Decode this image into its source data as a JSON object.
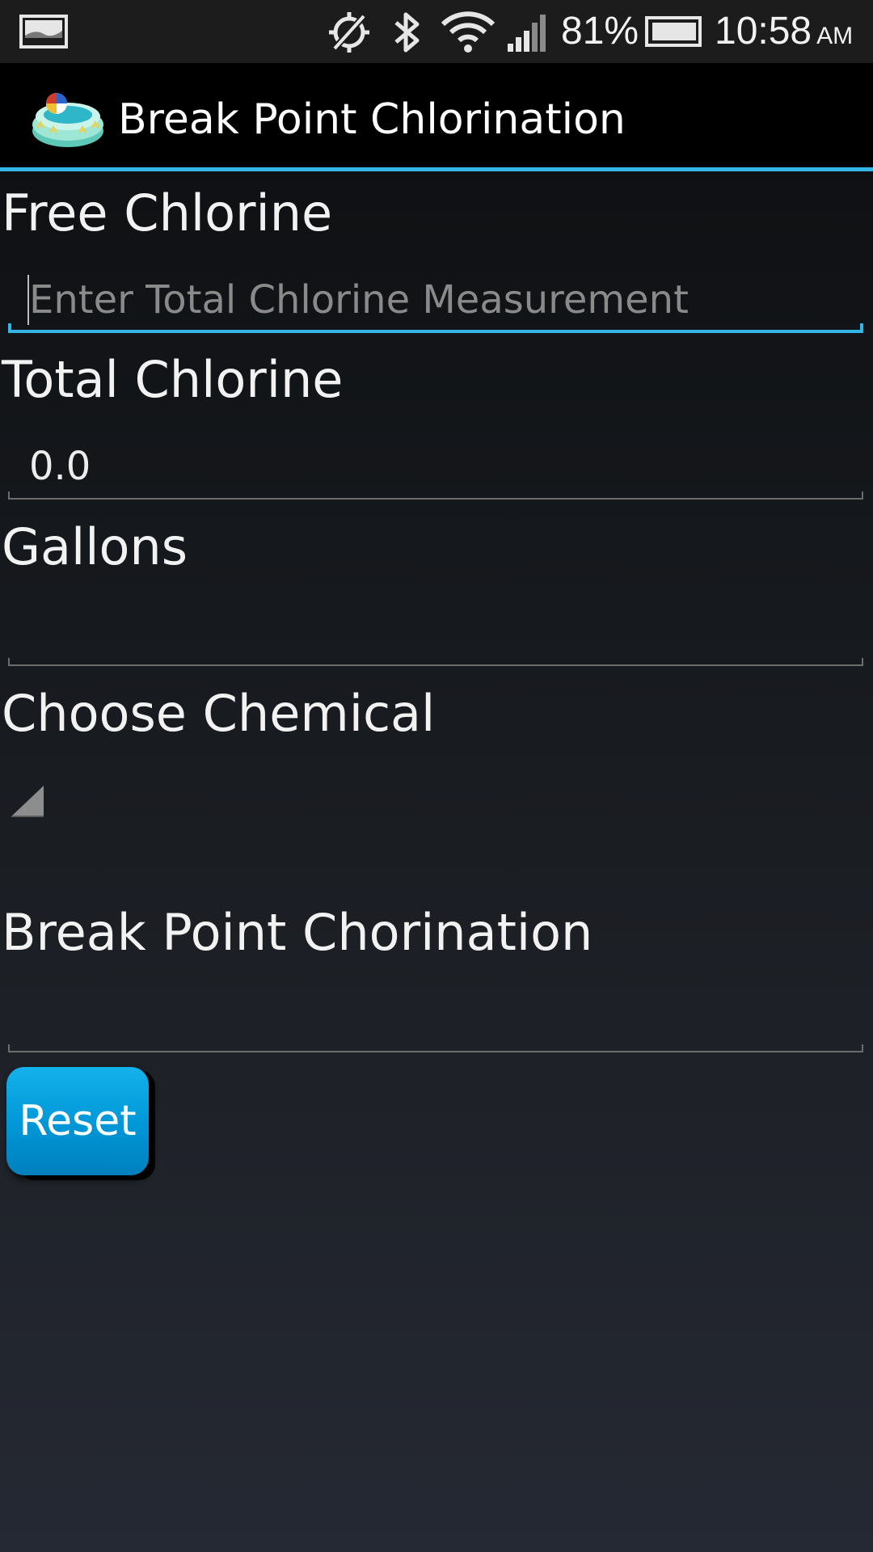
{
  "status_bar": {
    "battery_percent": "81%",
    "time": "10:58",
    "ampm": "AM",
    "icons": [
      "screenshot-icon",
      "sync-off-icon",
      "bluetooth-icon",
      "wifi-icon",
      "signal-icon",
      "battery-icon"
    ]
  },
  "app_bar": {
    "title": "Break Point Chlorination",
    "icon": "pool-icon"
  },
  "form": {
    "free_chlorine": {
      "label": "Free Chlorine",
      "placeholder": "Enter Total Chlorine Measurement",
      "value": ""
    },
    "total_chlorine": {
      "label": "Total Chlorine",
      "value": "0.0"
    },
    "gallons": {
      "label": "Gallons",
      "value": ""
    },
    "chemical": {
      "label": "Choose Chemical",
      "selected": ""
    },
    "break_point": {
      "label": "Break Point Chorination",
      "value": ""
    },
    "reset_label": "Reset"
  },
  "colors": {
    "accent": "#33b5e5",
    "button": "#0096d6"
  }
}
